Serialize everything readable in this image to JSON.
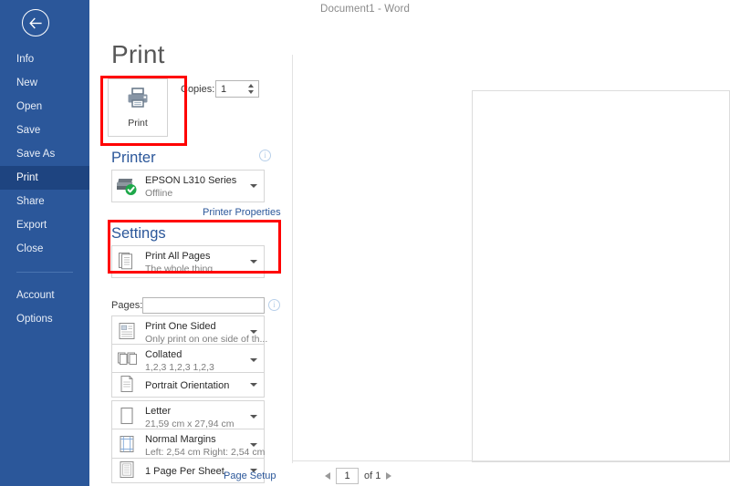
{
  "window": {
    "title": "Document1 - Word"
  },
  "sidebar": {
    "back_icon": "back-arrow-icon",
    "items": [
      {
        "label": "Info",
        "selected": false
      },
      {
        "label": "New",
        "selected": false
      },
      {
        "label": "Open",
        "selected": false
      },
      {
        "label": "Save",
        "selected": false
      },
      {
        "label": "Save As",
        "selected": false
      },
      {
        "label": "Print",
        "selected": true
      },
      {
        "label": "Share",
        "selected": false
      },
      {
        "label": "Export",
        "selected": false
      },
      {
        "label": "Close",
        "selected": false
      }
    ],
    "bottom_items": [
      {
        "label": "Account"
      },
      {
        "label": "Options"
      }
    ],
    "colors": {
      "background": "#2b579a",
      "selected": "#1e4480",
      "text": "#e8eef7"
    }
  },
  "main": {
    "page_title": "Print",
    "print_button": {
      "label": "Print",
      "icon": "printer-icon"
    },
    "copies": {
      "label": "Copies:",
      "value": "1"
    },
    "printer_section": {
      "heading": "Printer",
      "info_icon": "info-icon",
      "selected_printer": {
        "name": "EPSON L310 Series",
        "status": "Offline",
        "icon": "printer-status-icon"
      },
      "properties_link": "Printer Properties"
    },
    "settings_section": {
      "heading": "Settings",
      "info_icon": "info-icon",
      "pages_label": "Pages:",
      "pages_value": "",
      "page_setup_link": "Page Setup",
      "options": [
        {
          "name": "print-range",
          "title": "Print All Pages",
          "subtitle": "The whole thing",
          "icon": "document-pages-icon"
        },
        {
          "name": "print-sides",
          "title": "Print One Sided",
          "subtitle": "Only print on one side of th...",
          "icon": "one-sided-icon"
        },
        {
          "name": "collation",
          "title": "Collated",
          "subtitle": "1,2,3   1,2,3   1,2,3",
          "icon": "collate-icon"
        },
        {
          "name": "orientation",
          "title": "Portrait Orientation",
          "subtitle": "",
          "icon": "portrait-icon"
        },
        {
          "name": "paper-size",
          "title": "Letter",
          "subtitle": "21,59 cm x 27,94 cm",
          "icon": "paper-icon"
        },
        {
          "name": "margins",
          "title": "Normal Margins",
          "subtitle": "Left:  2,54 cm   Right:  2,54 cm",
          "icon": "margins-icon"
        },
        {
          "name": "pages-per-sheet",
          "title": "1 Page Per Sheet",
          "subtitle": "",
          "icon": "pages-per-sheet-icon"
        }
      ]
    }
  },
  "preview": {
    "pager": {
      "prev_icon": "prev-page-icon",
      "next_icon": "next-page-icon",
      "current_page": "1",
      "of_label": "of 1"
    }
  },
  "annotations": {
    "highlight_color": "#ff0000",
    "boxes": [
      {
        "name": "print-button-highlight",
        "label": "Print button"
      },
      {
        "name": "print-all-pages-highlight",
        "label": "Settings / Print All Pages"
      }
    ]
  }
}
